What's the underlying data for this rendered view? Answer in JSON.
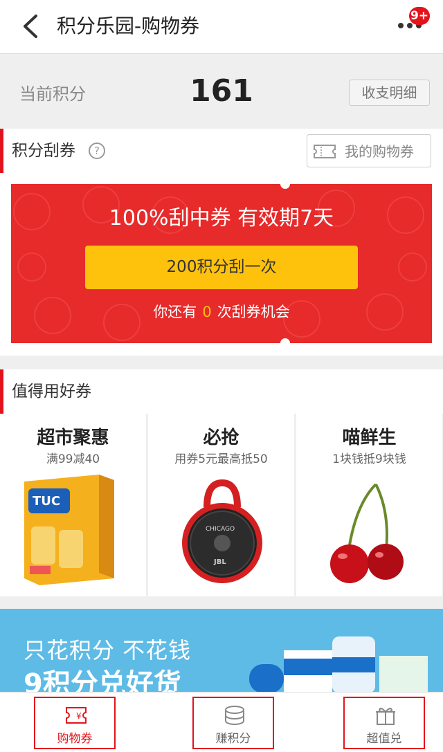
{
  "header": {
    "title": "积分乐园-购物券",
    "badge": "9+"
  },
  "points": {
    "label": "当前积分",
    "value": "161",
    "detail_button": "收支明细"
  },
  "scratch_section": {
    "title": "积分刮券",
    "help_symbol": "?",
    "my_coupons_button": "我的购物券",
    "card_title": "100%刮中券 有效期7天",
    "scratch_button": "200积分刮一次",
    "chance_prefix": "你还有",
    "chance_count": "0",
    "chance_suffix": "次刮券机会"
  },
  "good_coupons": {
    "title": "值得用好券",
    "items": [
      {
        "name": "超市聚惠",
        "desc": "满99减40",
        "image_icon": "cracker-box-icon"
      },
      {
        "name": "必抢",
        "desc": "用券5元最高抵50",
        "image_icon": "speaker-icon"
      },
      {
        "name": "喵鲜生",
        "desc": "1块钱抵9块钱",
        "image_icon": "cherry-icon"
      }
    ]
  },
  "banner": {
    "line1": "只花积分 不花钱",
    "line2": "9积分兑好货"
  },
  "tabbar": {
    "items": [
      {
        "label": "购物券",
        "icon": "coupon-icon",
        "active": true
      },
      {
        "label": "赚积分",
        "icon": "coins-icon",
        "active": false
      },
      {
        "label": "超值兑",
        "icon": "gift-icon",
        "active": false
      }
    ]
  },
  "colors": {
    "brand_red": "#e3131b",
    "card_red": "#e72a2a",
    "button_yellow": "#fec20d",
    "banner_blue": "#5ebbe6"
  }
}
